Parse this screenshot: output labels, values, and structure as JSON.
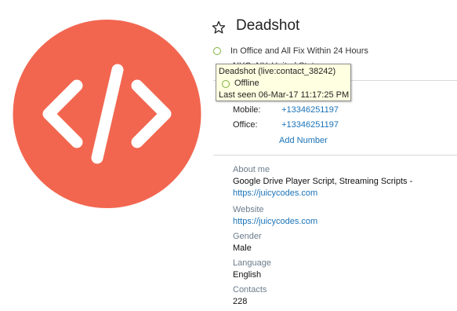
{
  "contact": {
    "name": "Deadshot",
    "status_message": "In Office and All Fix Within 24 Hours",
    "location_partial": "NYC, NY, United States"
  },
  "tooltip": {
    "title": "Deadshot (live:contact_38242)",
    "presence": "Offline",
    "last_seen": "Last seen 06-Mar-17 11:17:25 PM"
  },
  "phones": [
    {
      "label": "Mobile:",
      "value": "+13346251197"
    },
    {
      "label": "Office:",
      "value": "+13346251197"
    }
  ],
  "add_number_label": "Add Number",
  "about": {
    "label": "About me",
    "text": "Google Drive Player Script, Streaming Scripts -",
    "link": "https://juicycodes.com"
  },
  "website": {
    "label": "Website",
    "link": "https://juicycodes.com"
  },
  "gender": {
    "label": "Gender",
    "value": "Male"
  },
  "language": {
    "label": "Language",
    "value": "English"
  },
  "contacts": {
    "label": "Contacts",
    "value": "228"
  },
  "icons": {
    "avatar": "code-brackets-icon",
    "favorite": "star-outline-icon",
    "presence": "presence-circle-icon"
  },
  "colors": {
    "avatar_bg": "#f26650",
    "link": "#1a73b8",
    "presence": "#7cb342",
    "tooltip_bg": "#ffffe1",
    "label": "#6b7c8c"
  }
}
